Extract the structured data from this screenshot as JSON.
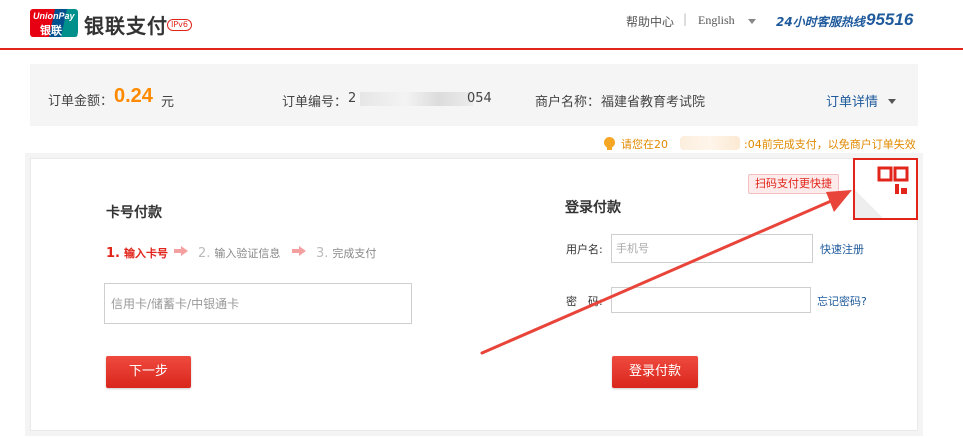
{
  "header": {
    "logo_text_en": "UnionPay",
    "logo_text_cn": "银联",
    "brand_name": "银联支付",
    "ipv6_badge": "IPv6",
    "help_center": "帮助中心",
    "separator": "|",
    "language": "English",
    "hotline_label": "24小时客服热线",
    "hotline_number": "95516"
  },
  "order": {
    "amount_label": "订单金额：",
    "amount_value": "0.24",
    "amount_unit": "元",
    "order_no_label": "订单编号：",
    "order_no_prefix": "2",
    "order_no_suffix": "054",
    "merchant_label": "商户名称：",
    "merchant_name": "福建省教育考试院",
    "detail_link": "订单详情"
  },
  "notice": {
    "prefix": "请您在20",
    "suffix": ":04前完成支付，以免商户订单失效"
  },
  "card_pay": {
    "title": "卡号付款",
    "steps": [
      {
        "num": "1.",
        "label": "输入卡号"
      },
      {
        "num": "2.",
        "label": "输入验证信息"
      },
      {
        "num": "3.",
        "label": "完成支付"
      }
    ],
    "card_placeholder": "信用卡/储蓄卡/中银通卡",
    "next_button": "下一步"
  },
  "login_pay": {
    "title": "登录付款",
    "username_label": "用户名:",
    "username_placeholder": "手机号",
    "register_link": "快速注册",
    "password_label": "密　码:",
    "forgot_link": "忘记密码?",
    "login_button": "登录付款"
  },
  "qr": {
    "tip": "扫码支付更快捷"
  },
  "colors": {
    "brand_red": "#e1251b",
    "amount_orange": "#ff8a00",
    "link_blue": "#1e5a9c"
  }
}
